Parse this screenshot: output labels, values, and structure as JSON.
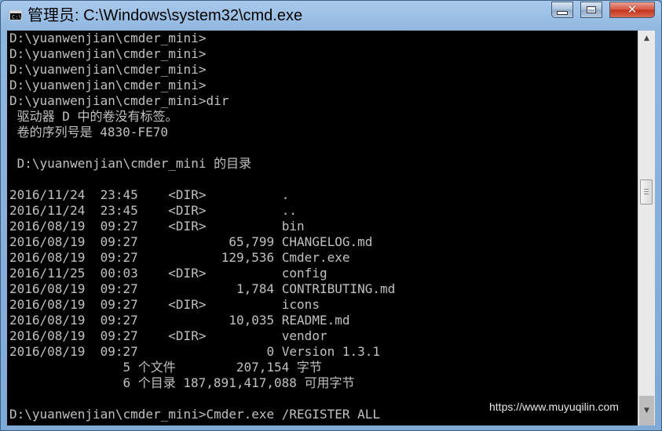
{
  "window": {
    "title": "管理员: C:\\Windows\\system32\\cmd.exe",
    "icon": "cmd-console-icon",
    "buttons": {
      "minimize": "minimize-icon",
      "maximize": "maximize-icon",
      "close": "close-icon",
      "close_glyph": "✕"
    }
  },
  "colors": {
    "console_bg": "#000000",
    "console_text": "#c0c0c0",
    "close_button": "#c8412a"
  },
  "console": {
    "lines": [
      "D:\\yuanwenjian\\cmder_mini>",
      "D:\\yuanwenjian\\cmder_mini>",
      "D:\\yuanwenjian\\cmder_mini>",
      "D:\\yuanwenjian\\cmder_mini>",
      "D:\\yuanwenjian\\cmder_mini>dir",
      " 驱动器 D 中的卷没有标签。",
      " 卷的序列号是 4830-FE70",
      "",
      " D:\\yuanwenjian\\cmder_mini 的目录",
      "",
      "2016/11/24  23:45    <DIR>          .",
      "2016/11/24  23:45    <DIR>          ..",
      "2016/08/19  09:27    <DIR>          bin",
      "2016/08/19  09:27            65,799 CHANGELOG.md",
      "2016/08/19  09:27           129,536 Cmder.exe",
      "2016/11/25  00:03    <DIR>          config",
      "2016/08/19  09:27             1,784 CONTRIBUTING.md",
      "2016/08/19  09:27    <DIR>          icons",
      "2016/08/19  09:27            10,035 README.md",
      "2016/08/19  09:27    <DIR>          vendor",
      "2016/08/19  09:27                 0 Version 1.3.1",
      "               5 个文件        207,154 字节",
      "               6 个目录 187,891,417,088 可用字节",
      "",
      "D:\\yuanwenjian\\cmder_mini>Cmder.exe /REGISTER ALL"
    ]
  },
  "watermark": "https://www.muyuqilin.com",
  "scrollbar": {
    "up_arrow": "▲",
    "down_arrow": "▼"
  }
}
